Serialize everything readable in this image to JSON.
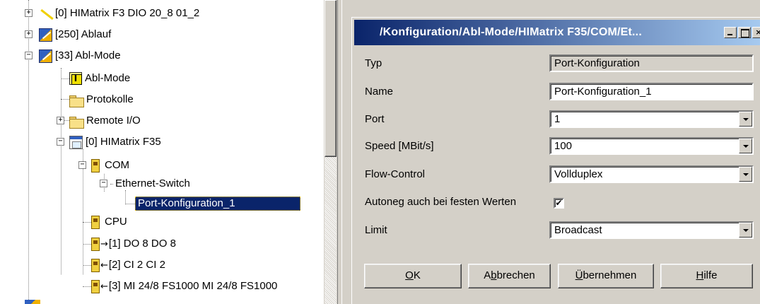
{
  "tree": {
    "items": [
      {
        "label": "[0] HIMatrix F3 DIO 20_8 01_2"
      },
      {
        "label": "[250] Ablauf"
      },
      {
        "label": "[33] Abl-Mode"
      },
      {
        "label": "Abl-Mode"
      },
      {
        "label": "Protokolle"
      },
      {
        "label": "Remote I/O"
      },
      {
        "label": "[0] HIMatrix F35"
      },
      {
        "label": "COM"
      },
      {
        "label": "Ethernet-Switch"
      },
      {
        "label": "Port-Konfiguration_1"
      },
      {
        "label": "CPU"
      },
      {
        "label": "[1] DO 8 DO 8"
      },
      {
        "label": "[2] CI 2 CI 2"
      },
      {
        "label": "[3] MI 24/8 FS1000 MI 24/8 FS1000"
      }
    ],
    "resource_icon_glyph": "I",
    "arrow_out": "→",
    "arrow_in": "←"
  },
  "dialog": {
    "title": "/Konfiguration/Abl-Mode/HIMatrix F35/COM/Et...",
    "close_glyph": "×",
    "fields": {
      "typ_label": "Typ",
      "typ_value": "Port-Konfiguration",
      "name_label": "Name",
      "name_value": "Port-Konfiguration_1",
      "port_label": "Port",
      "port_value": "1",
      "speed_label": "Speed [MBit/s]",
      "speed_value": "100",
      "flow_label": "Flow-Control",
      "flow_value": "Vollduplex",
      "autoneg_label": "Autoneg auch bei festen Werten",
      "autoneg_checked": true,
      "autoneg_mark": "✔",
      "limit_label": "Limit",
      "limit_value": "Broadcast"
    },
    "buttons": {
      "ok_u": "O",
      "ok_rest": "K",
      "cancel_pre": "A",
      "cancel_u": "b",
      "cancel_rest": "brechen",
      "apply_u": "Ü",
      "apply_rest": "bernehmen",
      "help_u": "H",
      "help_rest": "ilfe"
    }
  }
}
